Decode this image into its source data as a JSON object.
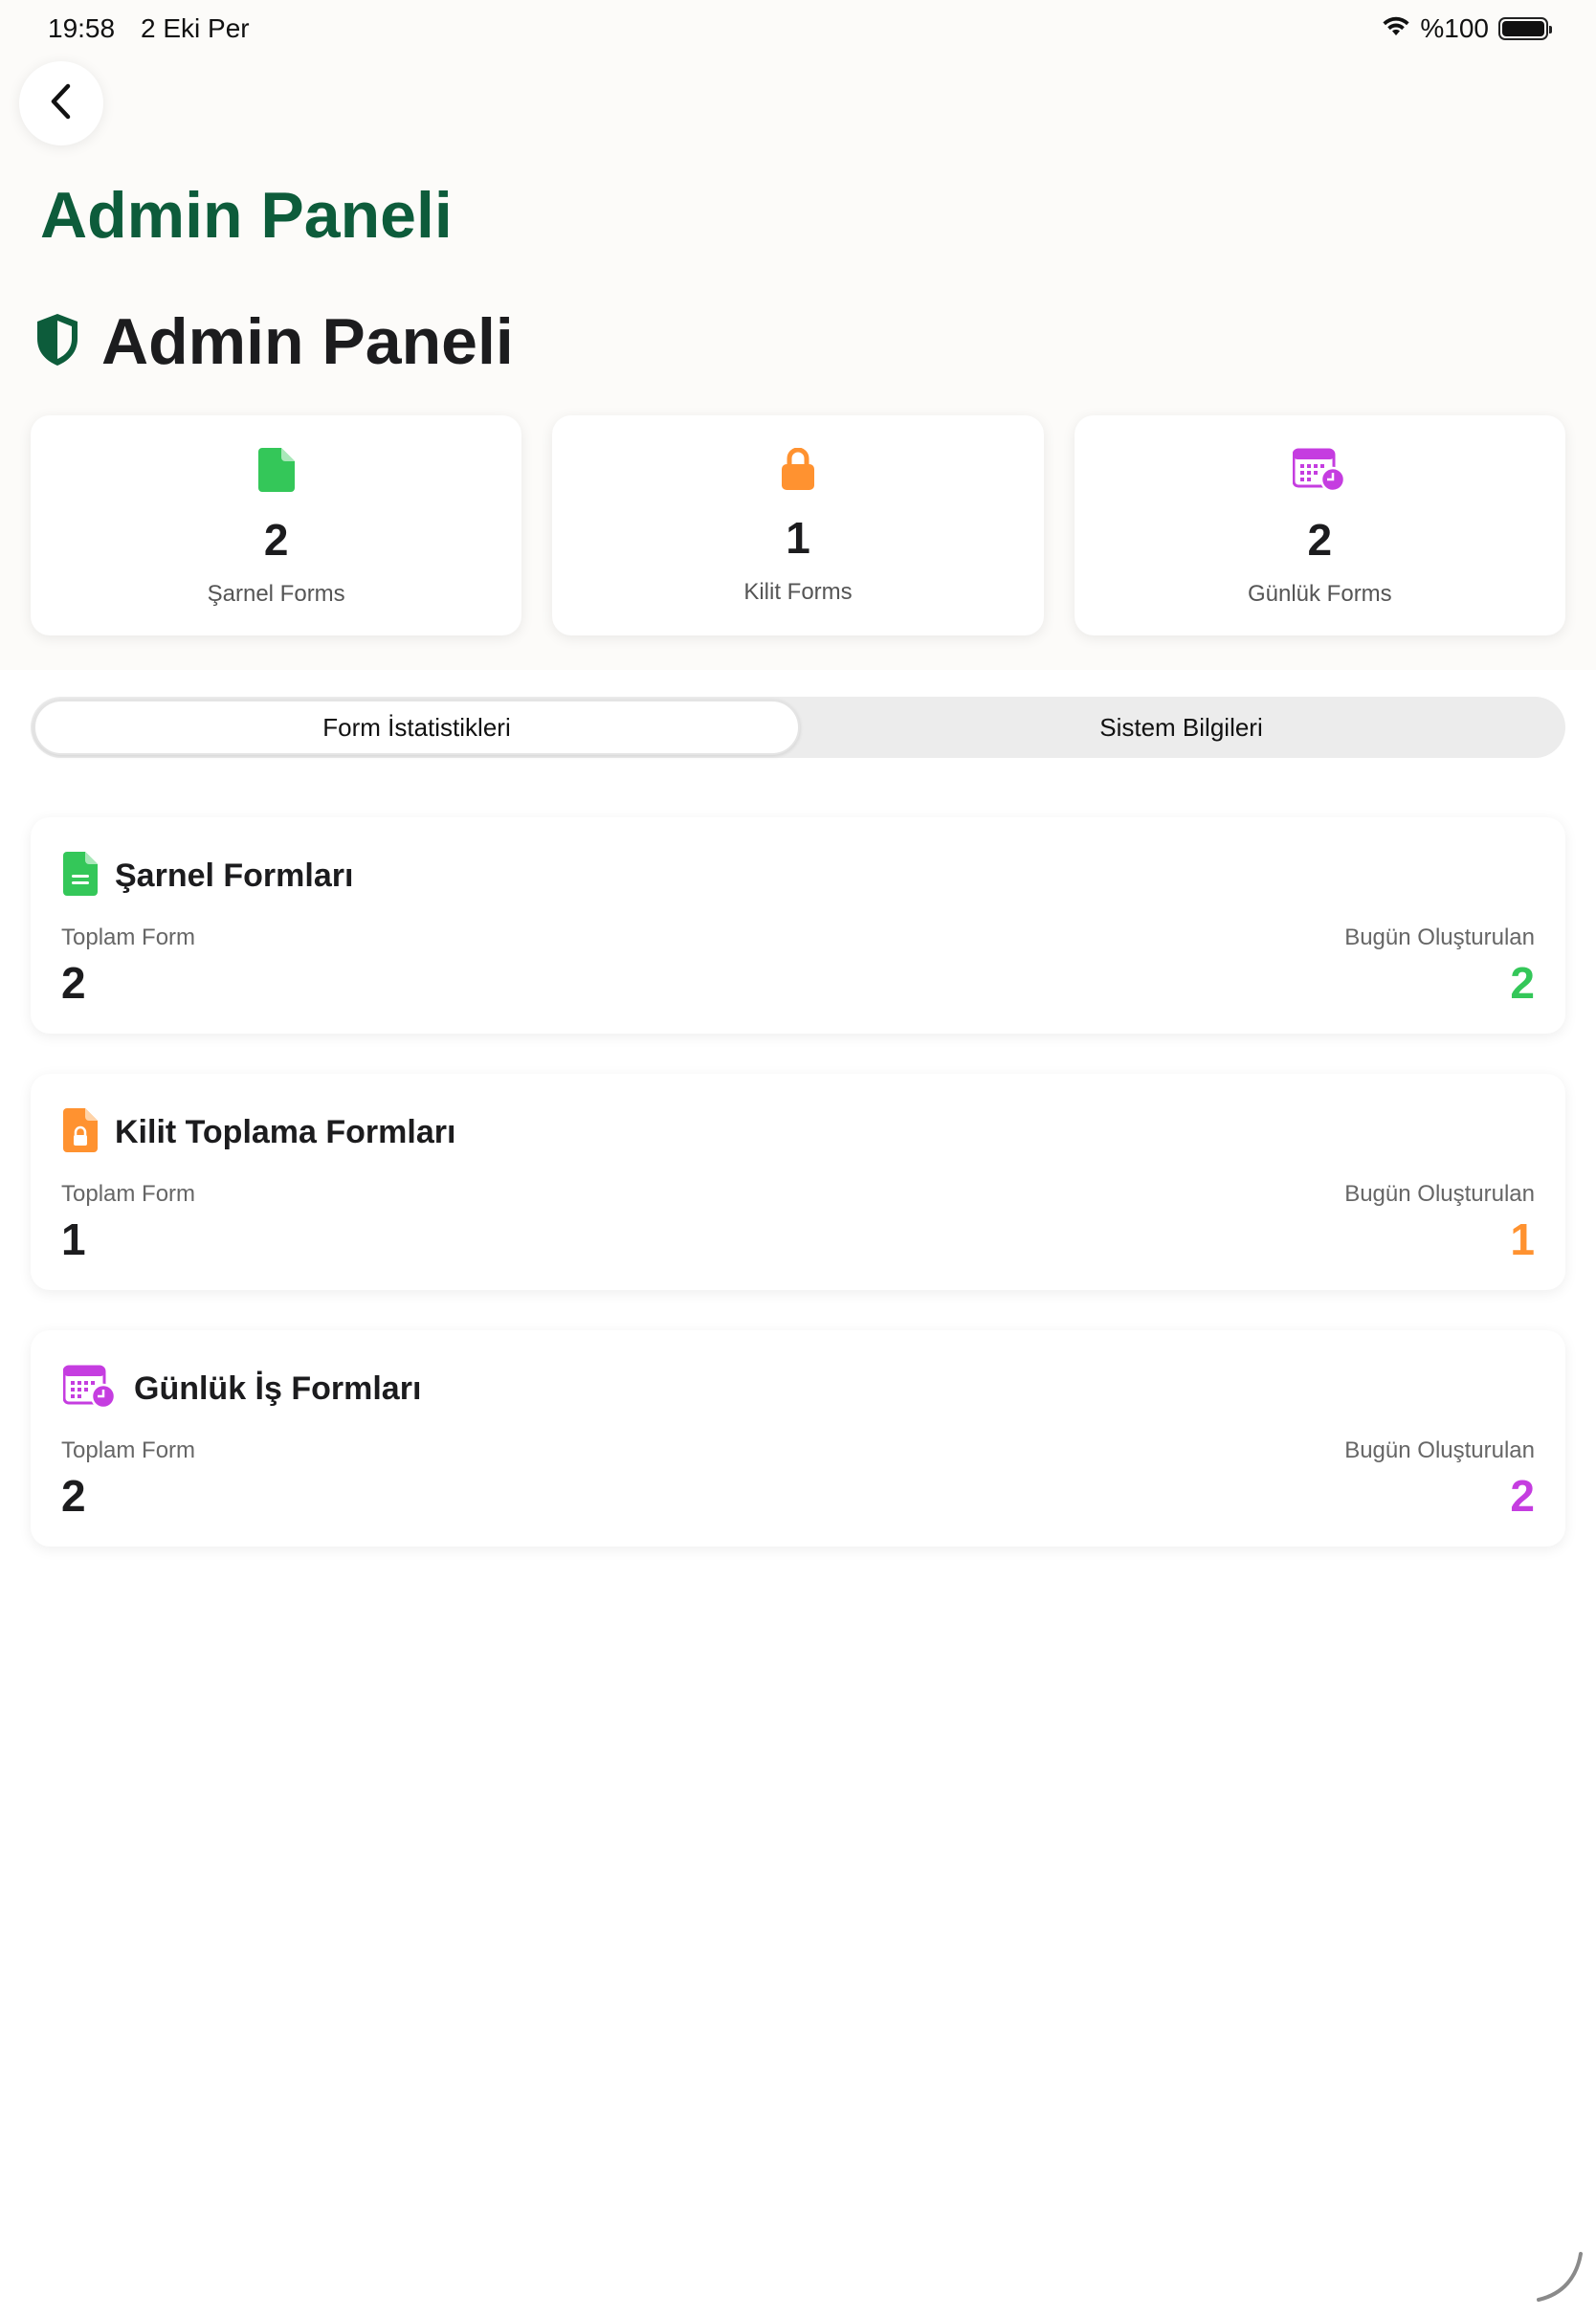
{
  "status_bar": {
    "time": "19:58",
    "date": "2 Eki Per",
    "battery": "%100"
  },
  "nav": {
    "title": "Admin Paneli",
    "back_icon": "chevron-left-icon"
  },
  "header": {
    "title": "Admin Paneli",
    "icon": "shield-icon"
  },
  "summary": [
    {
      "value": "2",
      "label": "Şarnel Forms",
      "icon": "document-icon",
      "color": "#34c759"
    },
    {
      "value": "1",
      "label": "Kilit Forms",
      "icon": "lock-icon",
      "color": "#ff9230"
    },
    {
      "value": "2",
      "label": "Günlük Forms",
      "icon": "calendar-clock-icon",
      "color": "#c53de0"
    }
  ],
  "tabs": [
    {
      "label": "Form İstatistikleri",
      "active": true
    },
    {
      "label": "Sistem Bilgileri",
      "active": false
    }
  ],
  "stats": [
    {
      "title": "Şarnel Formları",
      "total_label": "Toplam Form",
      "total": "2",
      "today_label": "Bugün Oluşturulan",
      "today": "2",
      "icon": "document-text-icon",
      "color": "#34c759"
    },
    {
      "title": "Kilit Toplama Formları",
      "total_label": "Toplam Form",
      "total": "1",
      "today_label": "Bugün Oluşturulan",
      "today": "1",
      "icon": "document-lock-icon",
      "color": "#ff9230"
    },
    {
      "title": "Günlük İş Formları",
      "total_label": "Toplam Form",
      "total": "2",
      "today_label": "Bugün Oluşturulan",
      "today": "2",
      "icon": "calendar-clock-icon",
      "color": "#c53de0"
    }
  ]
}
